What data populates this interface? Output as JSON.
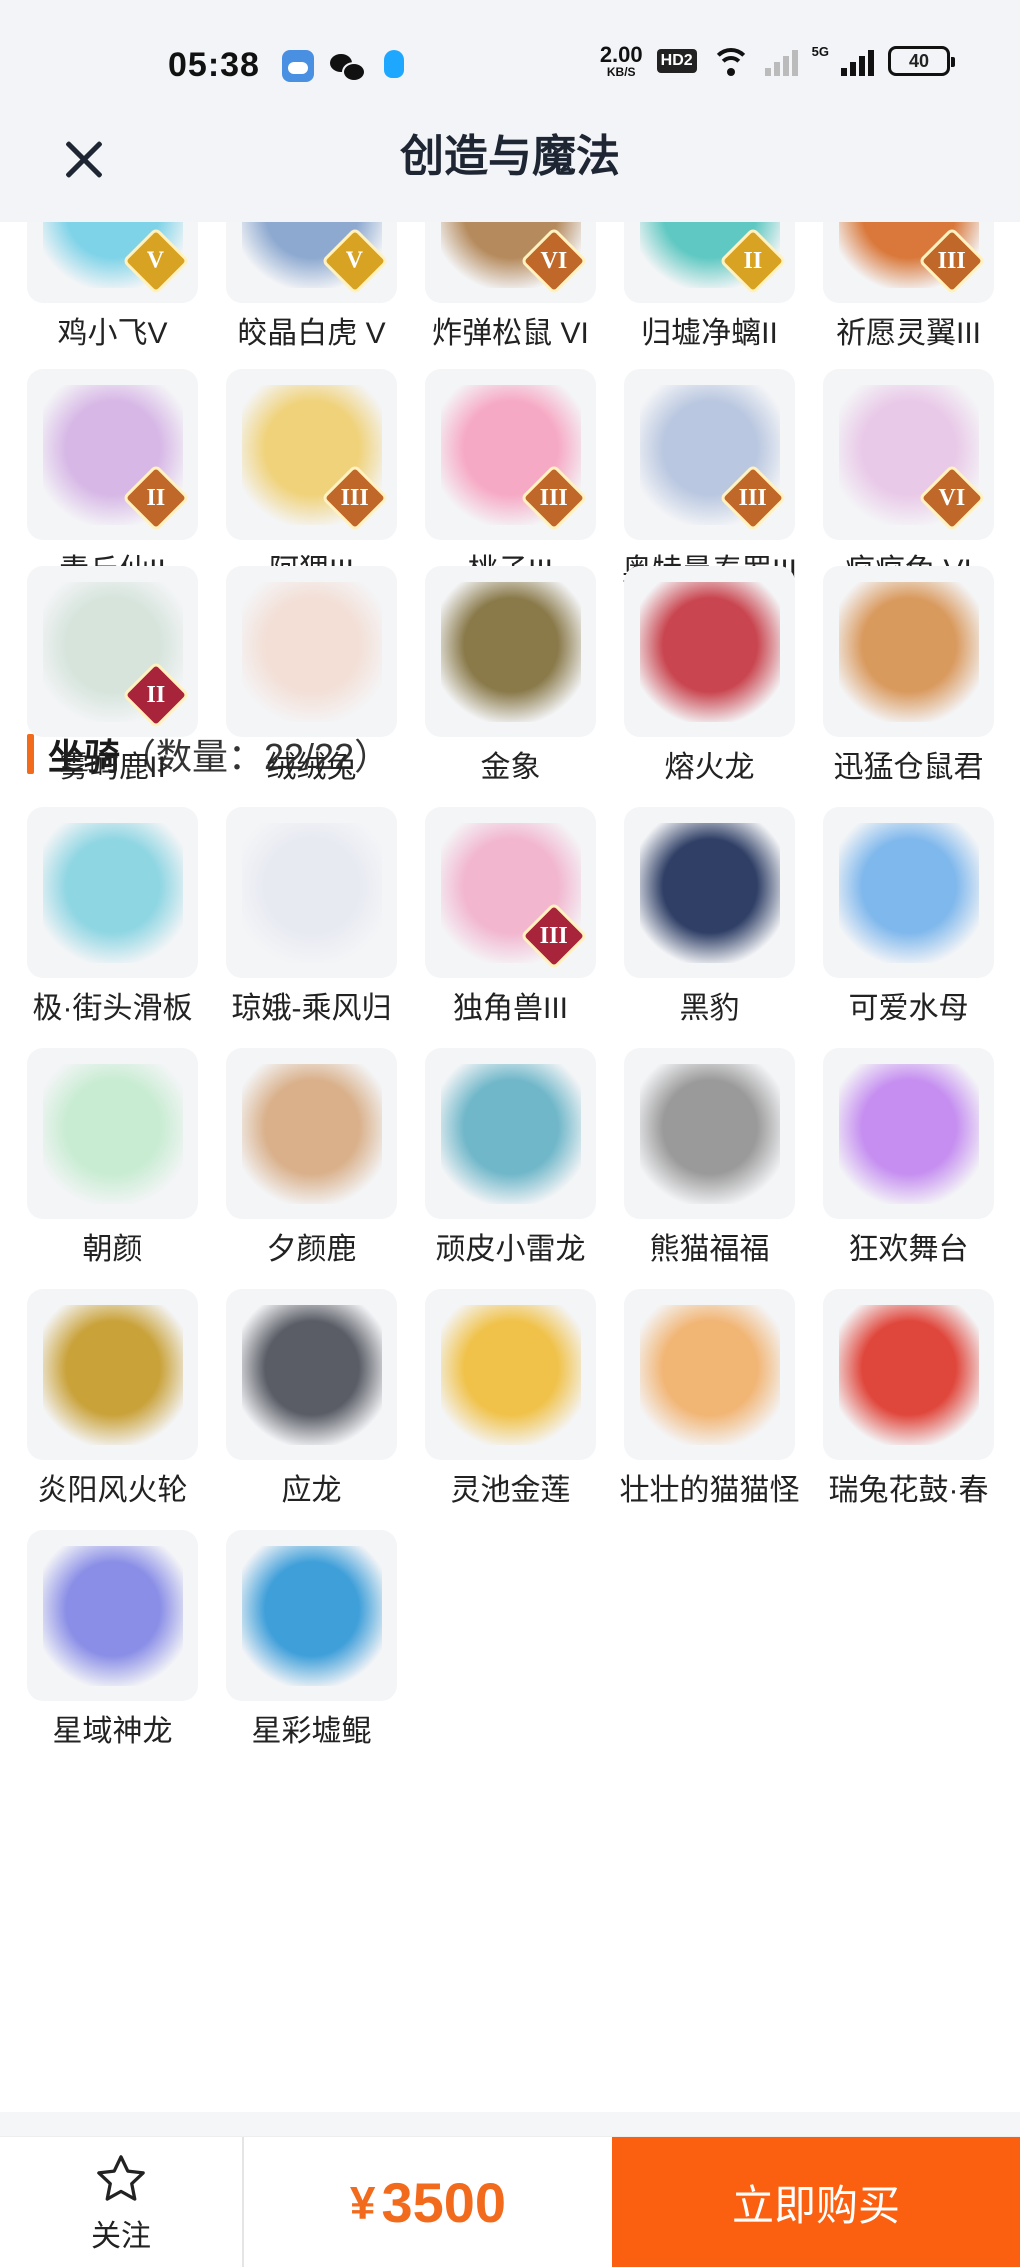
{
  "status_bar": {
    "time": "05:38",
    "net_speed": "2.00",
    "net_unit": "KB/S",
    "hd": "HD2",
    "network": "5G",
    "battery": "40"
  },
  "header": {
    "title": "创造与魔法"
  },
  "pets_top": [
    {
      "name": "鸡小飞V",
      "tier": "V",
      "tier_style": "gold",
      "color": "#7fd3e8"
    },
    {
      "name": "皎晶白虎 V",
      "tier": "V",
      "tier_style": "gold",
      "color": "#8da9d0"
    },
    {
      "name": "炸弹松鼠 VI",
      "tier": "VI",
      "tier_style": "bronze",
      "color": "#b58a5c"
    },
    {
      "name": "归墟净螭II",
      "tier": "II",
      "tier_style": "gold",
      "color": "#5fc8c2"
    },
    {
      "name": "祈愿灵翼III",
      "tier": "III",
      "tier_style": "bronze",
      "color": "#d9783a"
    },
    {
      "name": "青丘仙II",
      "tier": "II",
      "tier_style": "bronze",
      "color": "#d7b7e6"
    },
    {
      "name": "阿狸III",
      "tier": "III",
      "tier_style": "bronze",
      "color": "#f0d27a"
    },
    {
      "name": "桃子III",
      "tier": "III",
      "tier_style": "bronze",
      "color": "#f6a9c4"
    },
    {
      "name": "奥特曼泰罗III",
      "tier": "III",
      "tier_style": "bronze",
      "color": "#b9c7e0"
    },
    {
      "name": "疯疯兔 VI",
      "tier": "VI",
      "tier_style": "bronze",
      "color": "#e9c9e8"
    }
  ],
  "mounts_section": {
    "title": "坐骑",
    "count": "（数量：22/22）"
  },
  "mounts": [
    {
      "name": "雾屿鹿II",
      "tier": "II",
      "tier_style": "red",
      "color": "#d6e4dc"
    },
    {
      "name": "绒绒兔",
      "tier": "",
      "tier_style": "",
      "color": "#f3dfd6"
    },
    {
      "name": "金象",
      "tier": "",
      "tier_style": "",
      "color": "#8a7a4a"
    },
    {
      "name": "熔火龙",
      "tier": "",
      "tier_style": "",
      "color": "#c9454f"
    },
    {
      "name": "迅猛仓鼠君",
      "tier": "",
      "tier_style": "",
      "color": "#d99a5e"
    },
    {
      "name": "极·街头滑板",
      "tier": "",
      "tier_style": "",
      "color": "#8fd6e3"
    },
    {
      "name": "琼娥-乘风归",
      "tier": "",
      "tier_style": "",
      "color": "#e8eaf2"
    },
    {
      "name": "独角兽III",
      "tier": "III",
      "tier_style": "red",
      "color": "#f2b6cf"
    },
    {
      "name": "黑豹",
      "tier": "",
      "tier_style": "",
      "color": "#2f3f66"
    },
    {
      "name": "可爱水母",
      "tier": "",
      "tier_style": "",
      "color": "#7fb8ec"
    },
    {
      "name": "朝颜",
      "tier": "",
      "tier_style": "",
      "color": "#c8ecd2"
    },
    {
      "name": "夕颜鹿",
      "tier": "",
      "tier_style": "",
      "color": "#d9b08a"
    },
    {
      "name": "顽皮小雷龙",
      "tier": "",
      "tier_style": "",
      "color": "#6fb7c9"
    },
    {
      "name": "熊猫福福",
      "tier": "",
      "tier_style": "",
      "color": "#9a9a9a"
    },
    {
      "name": "狂欢舞台",
      "tier": "",
      "tier_style": "",
      "color": "#c58ef0"
    },
    {
      "name": "炎阳风火轮",
      "tier": "",
      "tier_style": "",
      "color": "#c9a23a"
    },
    {
      "name": "应龙",
      "tier": "",
      "tier_style": "",
      "color": "#5a5d66"
    },
    {
      "name": "灵池金莲",
      "tier": "",
      "tier_style": "",
      "color": "#f0c24a"
    },
    {
      "name": "壮壮的猫猫怪",
      "tier": "",
      "tier_style": "",
      "color": "#f1b574"
    },
    {
      "name": "瑞兔花鼓·春",
      "tier": "",
      "tier_style": "",
      "color": "#e0473c"
    },
    {
      "name": "星域神龙",
      "tier": "",
      "tier_style": "",
      "color": "#8a8ee6"
    },
    {
      "name": "星彩墟鲲",
      "tier": "",
      "tier_style": "",
      "color": "#3f9fd9"
    }
  ],
  "bottom_bar": {
    "follow_label": "关注",
    "currency": "¥",
    "price": "3500",
    "buy_label": "立即购买"
  }
}
